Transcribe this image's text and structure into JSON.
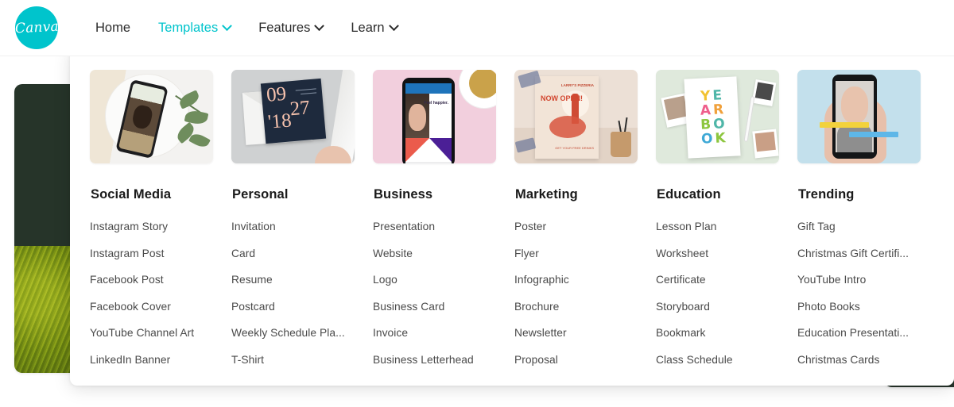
{
  "brand": {
    "color": "#00c4cc",
    "logo_text": "Canva",
    "logo_icon": "canva-logo-icon"
  },
  "nav": {
    "items": [
      {
        "label": "Home",
        "has_chevron": false,
        "active": false
      },
      {
        "label": "Templates",
        "has_chevron": true,
        "active": true
      },
      {
        "label": "Features",
        "has_chevron": true,
        "active": false
      },
      {
        "label": "Learn",
        "has_chevron": true,
        "active": false
      }
    ]
  },
  "dropdown": {
    "columns": [
      {
        "title": "Social Media",
        "thumbnail": "phone-on-marble-with-leaves-thumbnail",
        "links": [
          "Instagram Story",
          "Instagram Post",
          "Facebook Post",
          "Facebook Cover",
          "YouTube Channel Art",
          "LinkedIn Banner"
        ]
      },
      {
        "title": "Personal",
        "thumbnail": "navy-invitation-card-thumbnail",
        "thumbnail_text": {
          "line1": "09",
          "line2": "27",
          "line3": "'18"
        },
        "links": [
          "Invitation",
          "Card",
          "Resume",
          "Postcard",
          "Weekly Schedule Pla...",
          "T-Shirt"
        ]
      },
      {
        "title": "Business",
        "thumbnail": "phone-on-pink-background-thumbnail",
        "thumbnail_text": {
          "caption": "Feel happier."
        },
        "links": [
          "Presentation",
          "Website",
          "Logo",
          "Business Card",
          "Invoice",
          "Business Letterhead"
        ]
      },
      {
        "title": "Marketing",
        "thumbnail": "pizza-poster-thumbnail",
        "thumbnail_text": {
          "headline": "NOW OPEN!",
          "brand": "LARRY'S PIZZERIA",
          "info": "GET YOUR FREE DRINKS"
        },
        "links": [
          "Poster",
          "Flyer",
          "Infographic",
          "Brochure",
          "Newsletter",
          "Proposal"
        ]
      },
      {
        "title": "Education",
        "thumbnail": "yearbook-thumbnail",
        "thumbnail_text": {
          "r1": [
            "Y",
            "E"
          ],
          "r2": [
            "A",
            "R"
          ],
          "r3": [
            "B",
            "O"
          ],
          "r4": [
            "O",
            "K"
          ]
        },
        "links": [
          "Lesson Plan",
          "Worksheet",
          "Certificate",
          "Storyboard",
          "Bookmark",
          "Class Schedule"
        ]
      },
      {
        "title": "Trending",
        "thumbnail": "hand-holding-phone-thumbnail",
        "links": [
          "Gift Tag",
          "Christmas Gift Certifi...",
          "YouTube Intro",
          "Photo Books",
          "Education Presentati...",
          "Christmas Cards"
        ]
      }
    ]
  }
}
